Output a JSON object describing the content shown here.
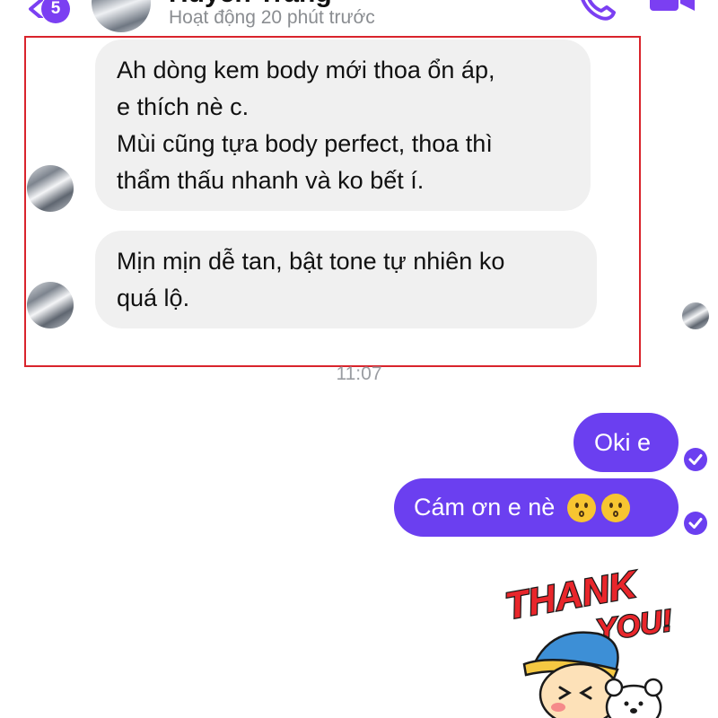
{
  "header": {
    "unread_count": "5",
    "contact_name": "Huyền Trang",
    "status": "Hoạt động 20 phút trước",
    "icons": [
      "back-chevron-icon",
      "phone-call-icon",
      "video-call-icon"
    ],
    "accent_color": "#7b3ff2"
  },
  "messages_received": [
    {
      "lines": [
        "Ah dòng kem body mới thoa ổn áp,",
        "e thích nè c.",
        "Mùi cũng tựa body perfect, thoa thì",
        "thẩm thấu nhanh và ko bết í."
      ]
    },
    {
      "lines": [
        "Mịn mịn dễ tan, bật tone tự nhiên ko",
        "quá lộ."
      ]
    }
  ],
  "timestamp": "11:07",
  "messages_sent": [
    {
      "text": "Oki e"
    },
    {
      "text": "Cám ơn e nè",
      "emoji": [
        "kissing-face-icon",
        "kissing-face-icon"
      ]
    }
  ],
  "sticker": {
    "text_line1": "THANK",
    "text_line2": "YOU!"
  },
  "colors": {
    "sent_bubble": "#6b3ff0",
    "received_bubble": "#f0f0f0",
    "highlight_border": "#d9242c"
  }
}
